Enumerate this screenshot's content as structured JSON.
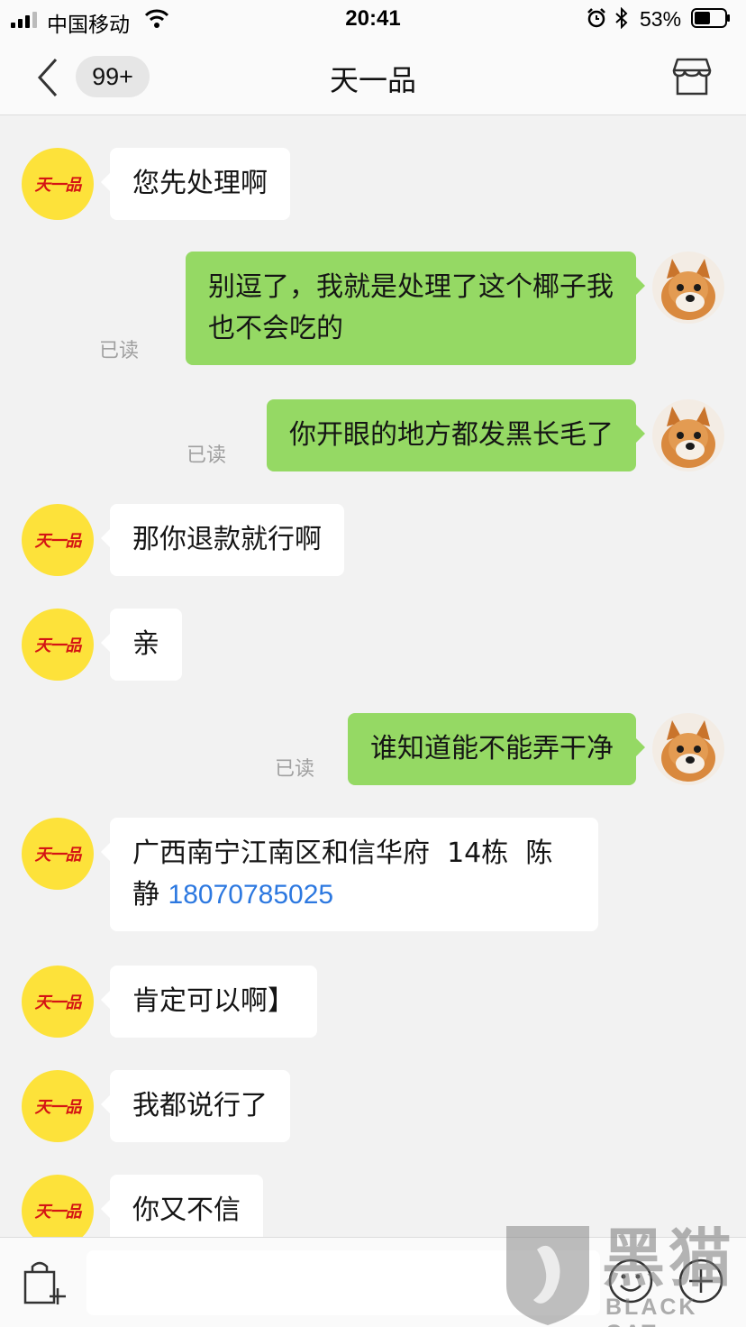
{
  "status_bar": {
    "carrier": "中国移动",
    "time": "20:41",
    "battery": "53%",
    "battery_level": 0.53,
    "icons": [
      "signal-icon",
      "wifi-icon",
      "alarm-icon",
      "bluetooth-icon",
      "battery-icon"
    ]
  },
  "nav": {
    "unread_badge": "99+",
    "title": "天一品",
    "icons": [
      "back-chevron-icon",
      "shop-icon"
    ]
  },
  "shop_avatar_text": "天一品",
  "read_label": "已读",
  "messages": [
    {
      "from": "shop",
      "text": "您先处理啊"
    },
    {
      "from": "user",
      "text": "别逗了，我就是处理了这个椰子我也不会吃的",
      "lines": [
        "别逗了，我就是处理了这个椰子我",
        "也不会吃的"
      ],
      "status": "已读"
    },
    {
      "from": "user",
      "text": "你开眼的地方都发黑长毛了",
      "status": "已读"
    },
    {
      "from": "shop",
      "text": "那你退款就行啊"
    },
    {
      "from": "shop",
      "text": "亲"
    },
    {
      "from": "user",
      "text": "谁知道能不能弄干净",
      "status": "已读"
    },
    {
      "from": "shop",
      "text_line1": "广西南宁江南区和信华府  14栋  陈",
      "text_line2": "静",
      "phone": "18070785025"
    },
    {
      "from": "shop",
      "text": "肯定可以啊】"
    },
    {
      "from": "shop",
      "text": "我都说行了"
    },
    {
      "from": "shop",
      "text": "你又不信"
    }
  ],
  "input_bar": {
    "placeholder": "",
    "icons": [
      "shopping-bag-add-icon",
      "emoji-icon",
      "plus-icon"
    ]
  },
  "watermark": {
    "cn": "黑猫",
    "en": "BLACK CAT"
  },
  "colors": {
    "outgoing_bubble": "#95d964",
    "incoming_bubble": "#ffffff",
    "background": "#f2f2f2",
    "shop_avatar": "#fde23a",
    "link": "#2c78e0"
  }
}
